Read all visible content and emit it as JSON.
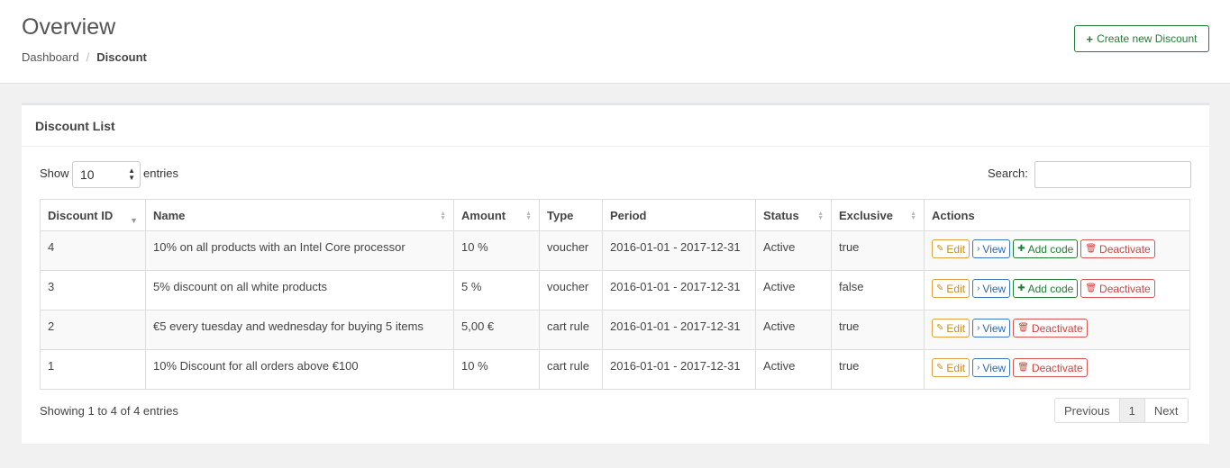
{
  "header": {
    "title": "Overview",
    "breadcrumb": [
      "Dashboard",
      "Discount"
    ],
    "create_button": "Create new Discount"
  },
  "panel": {
    "title": "Discount List",
    "show_label": "Show",
    "entries_value": "10",
    "entries_label": "entries",
    "search_label": "Search:",
    "search_value": ""
  },
  "table": {
    "columns": [
      "Discount ID",
      "Name",
      "Amount",
      "Type",
      "Period",
      "Status",
      "Exclusive",
      "Actions"
    ],
    "rows": [
      {
        "id": "4",
        "name": "10% on all products with an Intel Core processor",
        "amount": "10 %",
        "type": "voucher",
        "period": "2016-01-01 - 2017-12-31",
        "status": "Active",
        "exclusive": "true"
      },
      {
        "id": "3",
        "name": "5% discount on all white products",
        "amount": "5 %",
        "type": "voucher",
        "period": "2016-01-01 - 2017-12-31",
        "status": "Active",
        "exclusive": "false"
      },
      {
        "id": "2",
        "name": "€5 every tuesday and wednesday for buying 5 items",
        "amount": "5,00 €",
        "type": "cart rule",
        "period": "2016-01-01 - 2017-12-31",
        "status": "Active",
        "exclusive": "true"
      },
      {
        "id": "1",
        "name": "10% Discount for all orders above €100",
        "amount": "10 %",
        "type": "cart rule",
        "period": "2016-01-01 - 2017-12-31",
        "status": "Active",
        "exclusive": "true"
      }
    ],
    "actions": {
      "edit": "Edit",
      "view": "View",
      "add_code": "Add code",
      "deactivate": "Deactivate"
    }
  },
  "footer": {
    "info": "Showing 1 to 4 of 4 entries",
    "previous": "Previous",
    "page": "1",
    "next": "Next"
  },
  "colors": {
    "success": "#1e7e34",
    "warning": "#d08a1e",
    "primary": "#2a6ab0",
    "danger": "#d43f3a"
  },
  "icons": {
    "create": "plus-icon",
    "edit": "pencil-square-icon",
    "view": "chevron-right-icon",
    "add_code": "plus-icon",
    "deactivate": "trash-icon"
  }
}
